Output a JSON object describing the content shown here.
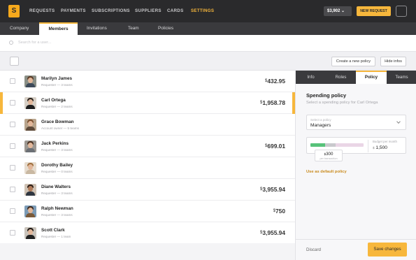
{
  "topnav": {
    "logo": "S",
    "items": [
      {
        "label": "REQUESTS",
        "active": false
      },
      {
        "label": "PAYMENTS",
        "active": false
      },
      {
        "label": "SUBSCRIPTIONS",
        "active": false
      },
      {
        "label": "SUPPLIERS",
        "active": false
      },
      {
        "label": "CARDS",
        "active": false
      },
      {
        "label": "SETTINGS",
        "active": true
      }
    ],
    "balance": "$3,902 ⌄",
    "new_request": "NEW REQUEST"
  },
  "subnav": {
    "tabs": [
      {
        "label": "Company"
      },
      {
        "label": "Members",
        "active": true
      },
      {
        "label": "Invitations"
      },
      {
        "label": "Team"
      },
      {
        "label": "Policies"
      }
    ]
  },
  "search": {
    "placeholder": "Search for a user..."
  },
  "toolbar": {
    "create_policy": "Create a new policy",
    "hide_infos": "Hide infos"
  },
  "members": [
    {
      "name": "Marilyn James",
      "role": "Requester — 3 teams",
      "currency": "$",
      "amount": "432.95"
    },
    {
      "name": "Carl Ortega",
      "role": "Requester — 2 teams",
      "currency": "$",
      "amount": "1,958.78",
      "selected": true
    },
    {
      "name": "Grace Bowman",
      "role": "Account owner — 5 teams",
      "currency": "",
      "amount": ""
    },
    {
      "name": "Jack Perkins",
      "role": "Requester — 3 teams",
      "currency": "$",
      "amount": "699.01"
    },
    {
      "name": "Dorothy Bailey",
      "role": "Requester — 0 teams",
      "currency": "",
      "amount": ""
    },
    {
      "name": "Diane Walters",
      "role": "Requester — 3 teams",
      "currency": "$",
      "amount": "3,955.94"
    },
    {
      "name": "Ralph Newman",
      "role": "Requester — 3 teams",
      "currency": "$",
      "amount": "750"
    },
    {
      "name": "Scott Clark",
      "role": "Requester — 1 team",
      "currency": "$",
      "amount": "3,955.94"
    }
  ],
  "panel": {
    "tabs": [
      {
        "label": "Info"
      },
      {
        "label": "Roles"
      },
      {
        "label": "Policy",
        "active": true
      },
      {
        "label": "Teams"
      }
    ],
    "title": "Spending policy",
    "subtitle": "Select a spending policy for Carl Ortega",
    "select": {
      "label": "Select a policy",
      "value": "Managers"
    },
    "budget": {
      "label": "Budget per month",
      "currency": "$",
      "value": "1,500",
      "spent_fraction": 0.28,
      "per_transaction_fraction": 0.2
    },
    "tooltip": {
      "currency": "$",
      "value": "300",
      "caption": "per transaction"
    },
    "default_link": "Use as default policy",
    "discard": "Discard",
    "save": "Save changes"
  },
  "colors": {
    "accent": "#f7b73c",
    "topbar": "#2a2a2c",
    "subnav": "#3a3a3d",
    "bar_green": "#57c27a"
  }
}
